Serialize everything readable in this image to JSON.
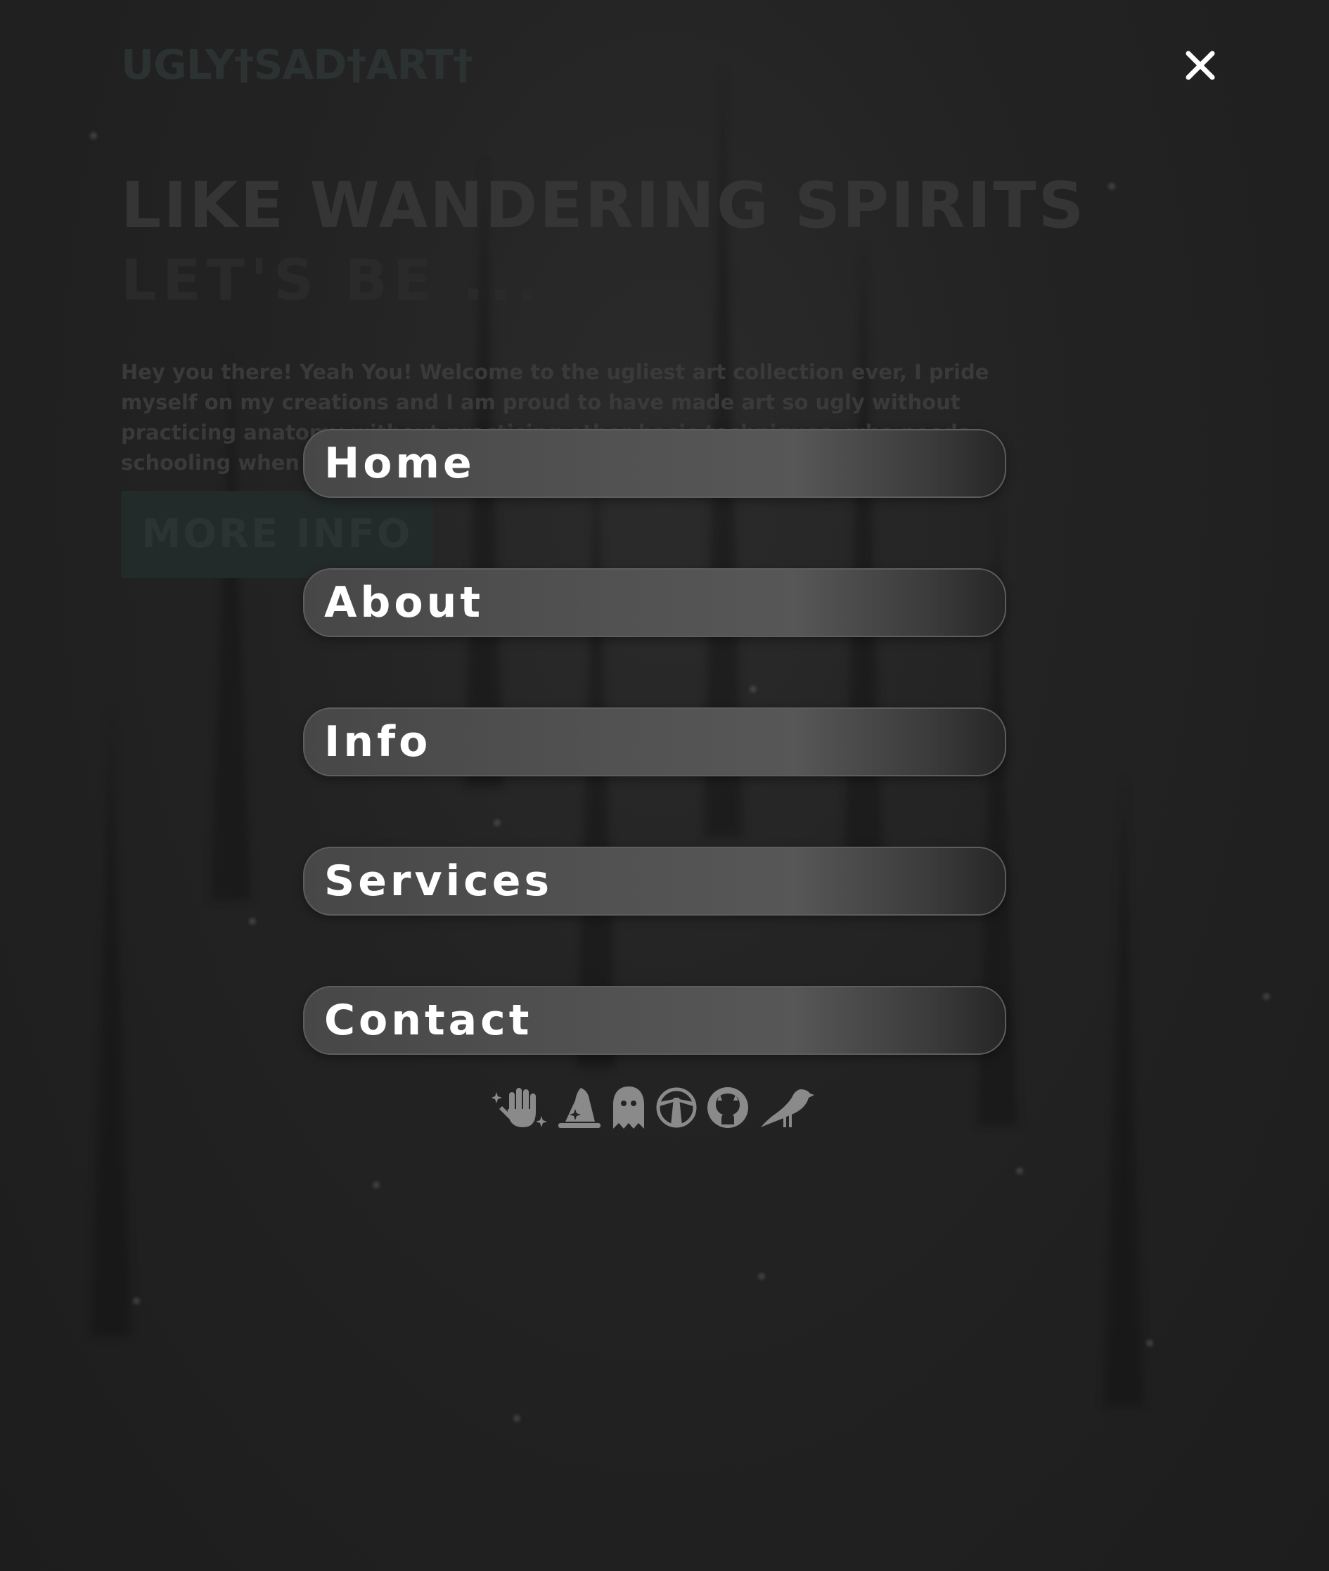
{
  "site": {
    "logo_text": "UGLY†SAD†ART†"
  },
  "hero": {
    "title": "LIKE WANDERING SPIRITS",
    "subtitle": "LET'S BE ...",
    "paragraph": "Hey you there! Yeah You! Welcome to the ugliest art collection ever, I pride myself on my creations and I am proud to have made art so ugly without practicing anatomy without practicing other basic techniques, who needs schooling when you can have fun :-)",
    "button_label": "MORE INFO"
  },
  "overlay_menu": {
    "close_icon": "close-icon",
    "items": [
      {
        "label": "Home"
      },
      {
        "label": "About"
      },
      {
        "label": "Info"
      },
      {
        "label": "Services"
      },
      {
        "label": "Contact"
      }
    ]
  },
  "social_icons": [
    {
      "icon": "magic-hand-icon"
    },
    {
      "icon": "wizard-hat-icon"
    },
    {
      "icon": "ghost-icon"
    },
    {
      "icon": "lighthouse-icon"
    },
    {
      "icon": "github-icon"
    },
    {
      "icon": "crow-icon"
    }
  ],
  "colors": {
    "background": "#1c1c1c",
    "menu_item_bg": "#525252",
    "menu_text": "#ffffff",
    "icon_color": "#8a8a8a"
  }
}
